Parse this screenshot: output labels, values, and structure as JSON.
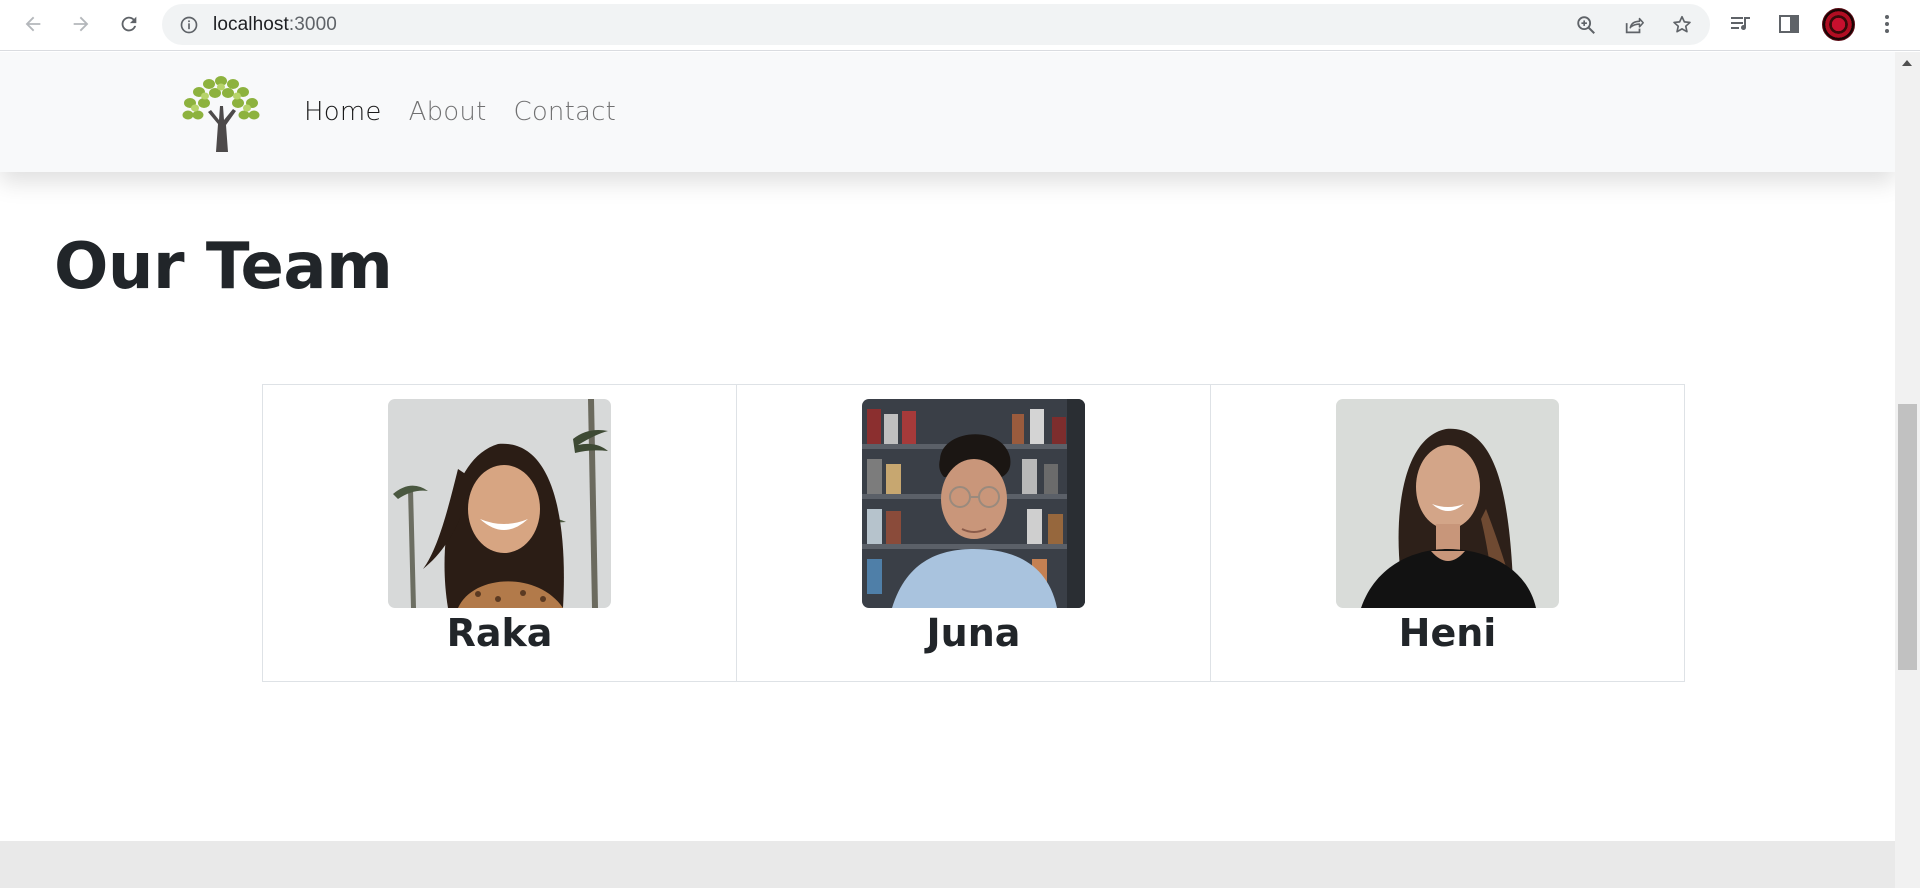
{
  "browser": {
    "url_host": "localhost",
    "url_port": ":3000",
    "icons": [
      "back-icon",
      "forward-icon",
      "reload-icon",
      "site-info-icon",
      "zoom-icon",
      "share-icon",
      "bookmark-star-icon",
      "reading-list-icon",
      "side-panel-icon",
      "profile-avatar",
      "kebab-menu-icon"
    ]
  },
  "nav": {
    "links": [
      {
        "label": "Home",
        "active": true
      },
      {
        "label": "About",
        "active": false
      },
      {
        "label": "Contact",
        "active": false
      }
    ]
  },
  "page": {
    "title": "Our Team"
  },
  "team": [
    {
      "name": "Raka"
    },
    {
      "name": "Juna"
    },
    {
      "name": "Heni"
    }
  ],
  "colors": {
    "navbar_bg": "#f8f9fa",
    "text_dark": "#212529",
    "nav_muted": "#8c8c8c",
    "card_border": "#dee2e6",
    "footer_bg": "#e9e9e9"
  }
}
